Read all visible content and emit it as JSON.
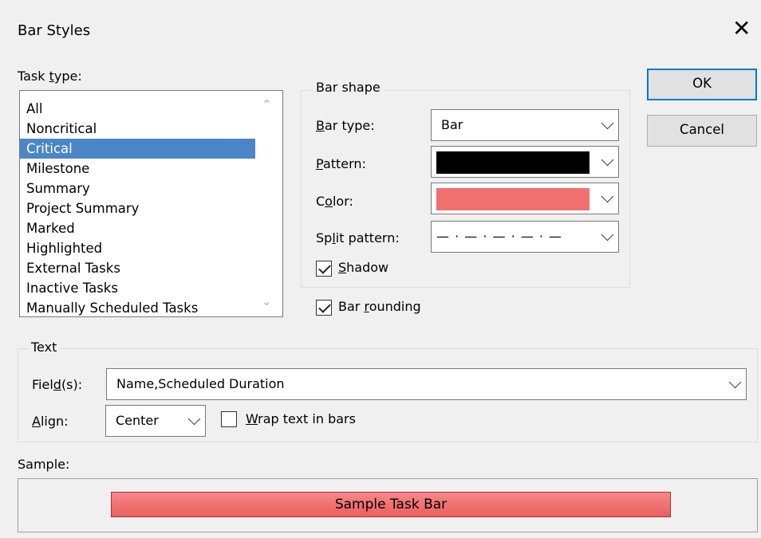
{
  "dialog": {
    "title": "Bar Styles",
    "close_glyph": "✕"
  },
  "task_type": {
    "label_pre": "Task ",
    "label_u": "t",
    "label_post": "ype:",
    "items": [
      "All",
      "Noncritical",
      "Critical",
      "Milestone",
      "Summary",
      "Project Summary",
      "Marked",
      "Highlighted",
      "External Tasks",
      "Inactive Tasks",
      "Manually Scheduled Tasks"
    ],
    "selected": "Critical"
  },
  "bar_shape": {
    "group_label": "Bar shape",
    "bar_type": {
      "label_u": "B",
      "label_post": "ar type:",
      "value": "Bar"
    },
    "pattern": {
      "label_u": "P",
      "label_post": "attern:",
      "color": "#000000"
    },
    "color": {
      "label_pre": "C",
      "label_u": "o",
      "label_post": "lor:",
      "color": "#f07070"
    },
    "split_pattern": {
      "label_pre": "Sp",
      "label_u": "l",
      "label_post": "it pattern:",
      "value": "— · — · — · — · —"
    },
    "shadow": {
      "label_u": "S",
      "label_post": "hadow",
      "checked": true
    }
  },
  "bar_rounding": {
    "label_pre": "Bar ",
    "label_u": "r",
    "label_post": "ounding",
    "checked": true
  },
  "buttons": {
    "ok": "OK",
    "cancel": "Cancel"
  },
  "text_group": {
    "group_label": "Text",
    "fields": {
      "label_pre": "Fiel",
      "label_u": "d",
      "label_post": "(s):",
      "value": "Name,Scheduled Duration"
    },
    "align": {
      "label_u": "A",
      "label_post": "lign:",
      "value": "Center"
    },
    "wrap": {
      "label_u": "W",
      "label_post": "rap text in bars",
      "checked": false
    }
  },
  "sample": {
    "label": "Sample:",
    "bar_text": "Sample Task Bar",
    "bar_color": "#f07070"
  }
}
